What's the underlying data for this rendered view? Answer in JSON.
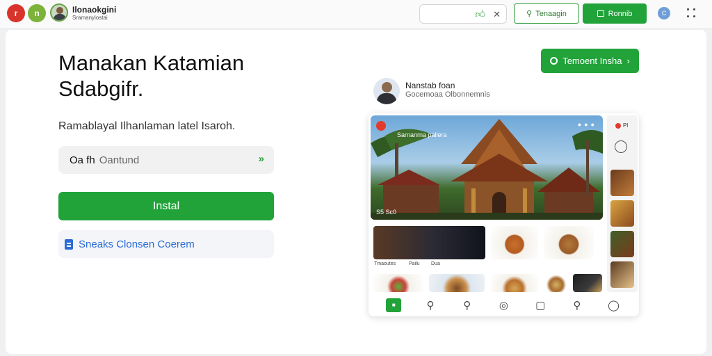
{
  "topbar": {
    "dot_left_label": "r",
    "dot_right_label": "n",
    "app_name": "Ilonaokgini",
    "app_sub": "Sramanyiostai",
    "user_initial": "C"
  },
  "header_actions": {
    "outline_button": "Tenaagin",
    "solid_button": "Ronnib"
  },
  "hero_text": {
    "headline_line1": "Manakan Katamian",
    "headline_line2": "Sdabgifr.",
    "subline": "Ramablayal Ilhanlaman latel Isaroh."
  },
  "form": {
    "field_value": "Oa fh",
    "field_placeholder": "Oantund",
    "install_label": "Instal",
    "link_label": "Sneaks Clonsen Coerem"
  },
  "try_button": "Temoent Insha",
  "profile": {
    "name": "Nanstab foan",
    "subtitle": "Gocemoaa Olbonnemnis"
  },
  "mockup": {
    "hero_title": "Sarnanrna pallera",
    "hero_caption": "S5 Sc0",
    "side_badge": "Pl",
    "thumb_captions": [
      "Tmaoutes",
      "Pailu",
      "Dua"
    ]
  },
  "colors": {
    "accent_green": "#21a33a",
    "link_blue": "#2a6bd6",
    "danger_red": "#d9342b"
  }
}
